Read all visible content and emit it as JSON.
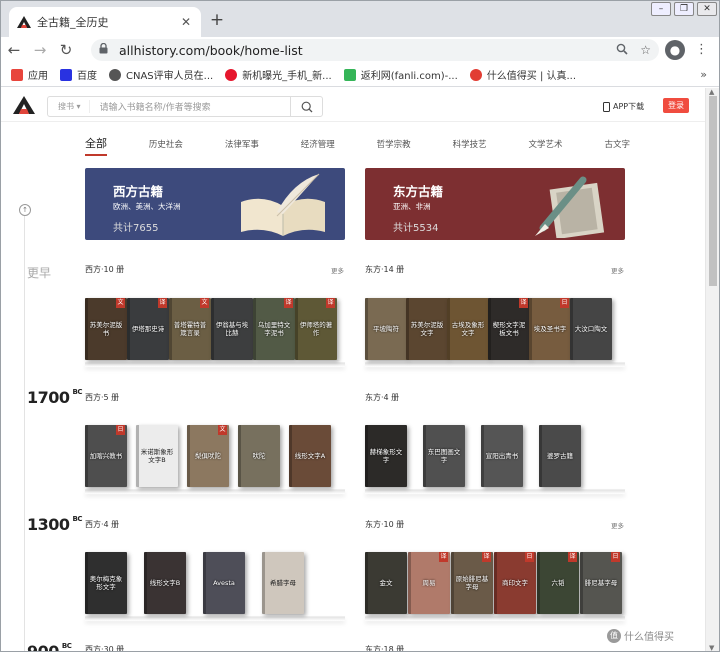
{
  "browser": {
    "tab_title": "全古籍_全历史",
    "url": "allhistory.com/book/home-list",
    "bookmarks": [
      {
        "label": "应用",
        "color": "#e8453c"
      },
      {
        "label": "百度",
        "color": "#2932e1"
      },
      {
        "label": "CNAS评审人员在...",
        "color": "#555555"
      },
      {
        "label": "新机曝光_手机_新...",
        "color": "#e6162d"
      },
      {
        "label": "返利网(fanli.com)-...",
        "color": "#35b558"
      },
      {
        "label": "什么值得买 | 认真...",
        "color": "#e23d33"
      }
    ],
    "bookmarks_more": "»"
  },
  "site": {
    "search_scope": "搜书 ▾",
    "search_placeholder": "请输入书籍名称/作者等搜索",
    "app_download": "APP下载",
    "login": "登录",
    "categories": [
      "全部",
      "历史社会",
      "法律军事",
      "经济管理",
      "哲学宗教",
      "科学技艺",
      "文学艺术",
      "古文字"
    ],
    "hero": [
      {
        "title": "西方古籍",
        "sub": "欧洲、美洲、大洋洲",
        "count": "共计7655",
        "bg": "#3d4a7c"
      },
      {
        "title": "东方古籍",
        "sub": "亚洲、非洲",
        "count": "共计5534",
        "bg": "#7d2f31"
      }
    ],
    "more": "更多",
    "era_early": "更早",
    "timeline_icon": "↑",
    "years": [
      {
        "num": "1700",
        "suffix": "BC"
      },
      {
        "num": "1300",
        "suffix": "BC"
      },
      {
        "num": "900",
        "suffix": "BC"
      }
    ],
    "sections": [
      {
        "west": "西方·10 册",
        "east": "东方·14 册",
        "west_more": true,
        "east_more": true
      },
      {
        "west": "西方·5 册",
        "east": "东方·4 册",
        "west_more": false,
        "east_more": false
      },
      {
        "west": "西方·4 册",
        "east": "东方·10 册",
        "west_more": false,
        "east_more": true
      },
      {
        "west": "西方·30 册",
        "east": "东方·18 册",
        "west_more": false,
        "east_more": false
      }
    ],
    "books": {
      "s1w": [
        {
          "t": "苏美尔泥版书",
          "tag": "文",
          "bg": "#4b3a2b"
        },
        {
          "t": "伊塔那史诗",
          "tag": "译",
          "bg": "#3a3c3e"
        },
        {
          "t": "普塔霍特普箴言录",
          "tag": "文",
          "bg": "#6b5e44"
        },
        {
          "t": "伊翁基与埃比赫",
          "tag": "",
          "bg": "#3d3e3f"
        },
        {
          "t": "乌加里特文字泥书",
          "tag": "译",
          "bg": "#525a46"
        },
        {
          "t": "伊师塔的著作",
          "tag": "译",
          "bg": "#5e5836"
        }
      ],
      "s1e": [
        {
          "t": "平坡陶符",
          "tag": "",
          "bg": "#7a6a52"
        },
        {
          "t": "苏美尔泥版文字",
          "tag": "",
          "bg": "#5b4630"
        },
        {
          "t": "古埃及象形文字",
          "tag": "",
          "bg": "#6e5533"
        },
        {
          "t": "楔形文字泥板文书",
          "tag": "译",
          "bg": "#2e2b29"
        },
        {
          "t": "埃及圣书字",
          "tag": "日",
          "bg": "#775c3f"
        },
        {
          "t": "大汶口陶文",
          "tag": "",
          "bg": "#454545"
        }
      ],
      "s2w": [
        {
          "t": "加喀兴教书",
          "tag": "日",
          "bg": "#4e4e4e"
        },
        {
          "t": "米诺斯象形文字B",
          "tag": "",
          "bg": "#ececec"
        },
        {
          "t": "梨俱吠陀",
          "tag": "文",
          "bg": "#8c7860"
        },
        {
          "t": "吠陀",
          "tag": "",
          "bg": "#77705e"
        },
        {
          "t": "线形文字A",
          "tag": "",
          "bg": "#6a4b38"
        }
      ],
      "s2e": [
        {
          "t": "赫梯象形文字",
          "tag": "",
          "bg": "#2c2a28"
        },
        {
          "t": "东巴图画文字",
          "tag": "",
          "bg": "#505050"
        },
        {
          "t": "宣阳出青书",
          "tag": "",
          "bg": "#555555"
        },
        {
          "t": "婆罗古籍",
          "tag": "",
          "bg": "#4a4a4a"
        }
      ],
      "s3w": [
        {
          "t": "奥尔梅克象形文字",
          "tag": "",
          "bg": "#2f2f2f"
        },
        {
          "t": "线形文字B",
          "tag": "",
          "bg": "#3a3333"
        },
        {
          "t": "Avesta",
          "tag": "",
          "bg": "#4e4e58"
        },
        {
          "t": "希腊字母",
          "tag": "",
          "bg": "#cfc7bd"
        }
      ],
      "s3e": [
        {
          "t": "金文",
          "tag": "",
          "bg": "#3b3a33"
        },
        {
          "t": "周易",
          "tag": "译",
          "bg": "#b07a6a"
        },
        {
          "t": "原始腓尼基字母",
          "tag": "译",
          "bg": "#6a5a48"
        },
        {
          "t": "商印文字",
          "tag": "日",
          "bg": "#8a3b30"
        },
        {
          "t": "六韬",
          "tag": "译",
          "bg": "#3c4634"
        },
        {
          "t": "腓尼基字母",
          "tag": "日",
          "bg": "#555550"
        }
      ]
    },
    "watermark": "什么值得买",
    "watermark_icon": "值"
  }
}
